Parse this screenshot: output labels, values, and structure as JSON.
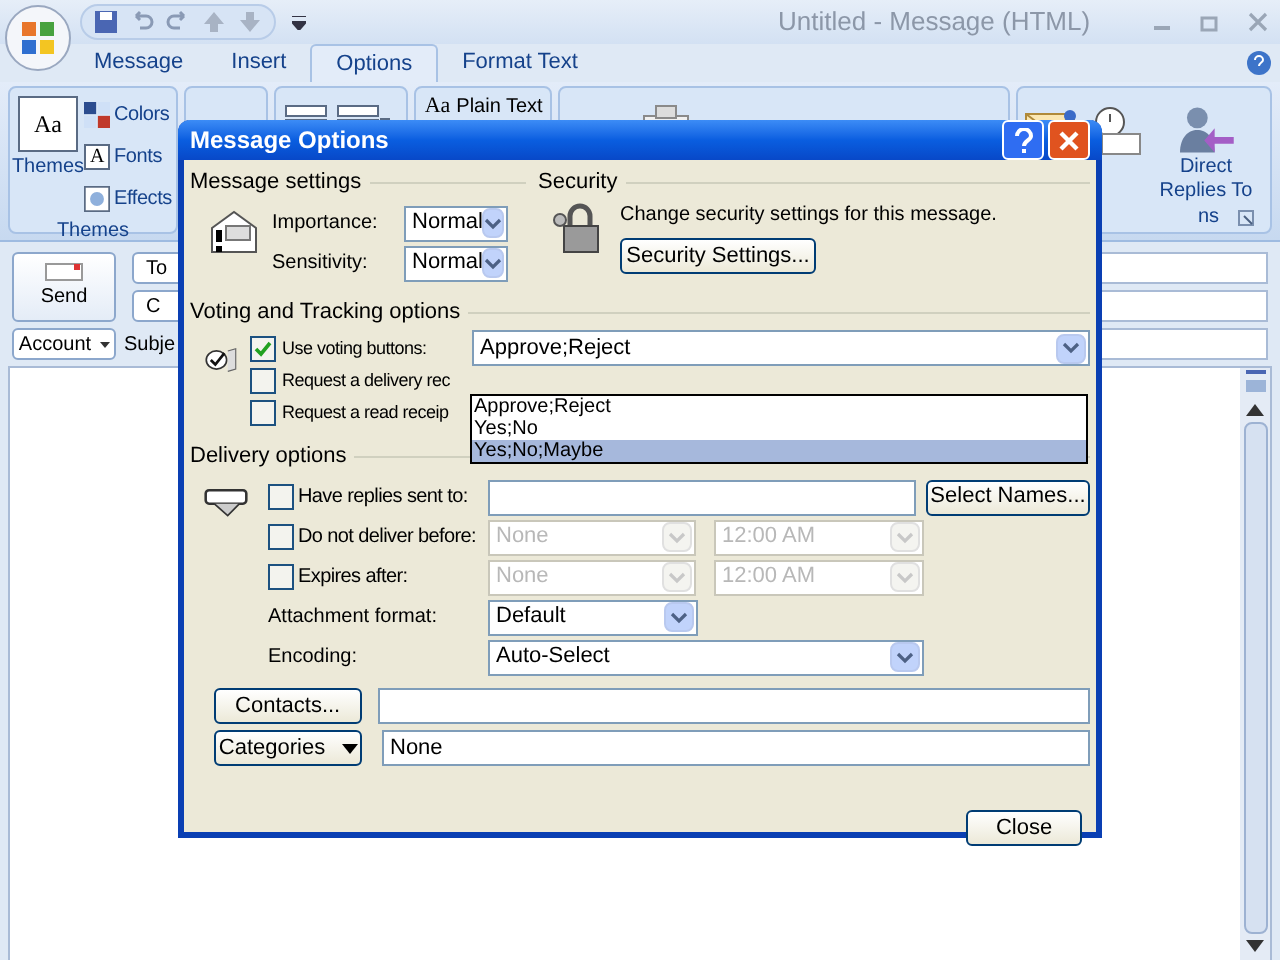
{
  "window": {
    "title": "Untitled - Message (HTML)"
  },
  "ribbon_tabs": [
    {
      "label": "Message",
      "selected": false
    },
    {
      "label": "Insert",
      "selected": false
    },
    {
      "label": "Options",
      "selected": true
    },
    {
      "label": "Format Text",
      "selected": false
    }
  ],
  "ribbon": {
    "themes_group": {
      "label": "Themes",
      "themes_button": {
        "icon_text": "Aa",
        "label": "Themes"
      },
      "items": [
        {
          "kind": "colors",
          "label": "Colors"
        },
        {
          "kind": "fonts",
          "icon_text": "A",
          "label": "Fonts"
        },
        {
          "kind": "effects",
          "label": "Effects"
        }
      ]
    },
    "plain_text": {
      "icon_text": "Aa",
      "label": "Plain Text"
    },
    "more_group": {
      "label": "ns",
      "direct_replies": "Direct Replies To"
    }
  },
  "address": {
    "send": "Send",
    "to": "To",
    "cc": "C",
    "account": "Account",
    "subject": "Subje"
  },
  "dialog": {
    "title": "Message Options",
    "message_settings": {
      "heading": "Message settings",
      "fields": [
        {
          "label": "Importance:",
          "value": "Normal"
        },
        {
          "label": "Sensitivity:",
          "value": "Normal"
        }
      ]
    },
    "security": {
      "heading": "Security",
      "text": "Change security settings for this message.",
      "button": "Security Settings..."
    },
    "voting": {
      "heading": "Voting and Tracking options",
      "options": [
        {
          "label": "Use voting buttons:",
          "checked": true
        },
        {
          "label": "Request a delivery rec",
          "checked": false
        },
        {
          "label": "Request a read receip",
          "checked": false
        }
      ],
      "value": "Approve;Reject",
      "dropdown": {
        "expanded": true,
        "items": [
          {
            "label": "Approve;Reject",
            "selected": false
          },
          {
            "label": "Yes;No",
            "selected": false
          },
          {
            "label": "Yes;No;Maybe",
            "selected": true
          }
        ]
      }
    },
    "delivery": {
      "heading": "Delivery options",
      "rows": [
        {
          "kind": "recipient",
          "label": "Have replies sent to:",
          "checked": false,
          "button": "Select Names..."
        },
        {
          "kind": "datetime",
          "label": "Do not deliver before:",
          "checked": false,
          "date": "None",
          "time": "12:00 AM",
          "disabled": true
        },
        {
          "kind": "datetime",
          "label": "Expires after:",
          "checked": false,
          "date": "None",
          "time": "12:00 AM",
          "disabled": true
        },
        {
          "kind": "select",
          "label": "Attachment format:",
          "value": "Default"
        },
        {
          "kind": "wide_select",
          "label": "Encoding:",
          "value": "Auto-Select"
        }
      ]
    },
    "contacts": {
      "button": "Contacts..."
    },
    "categories": {
      "button": "Categories",
      "value": "None"
    },
    "close_button": "Close"
  }
}
